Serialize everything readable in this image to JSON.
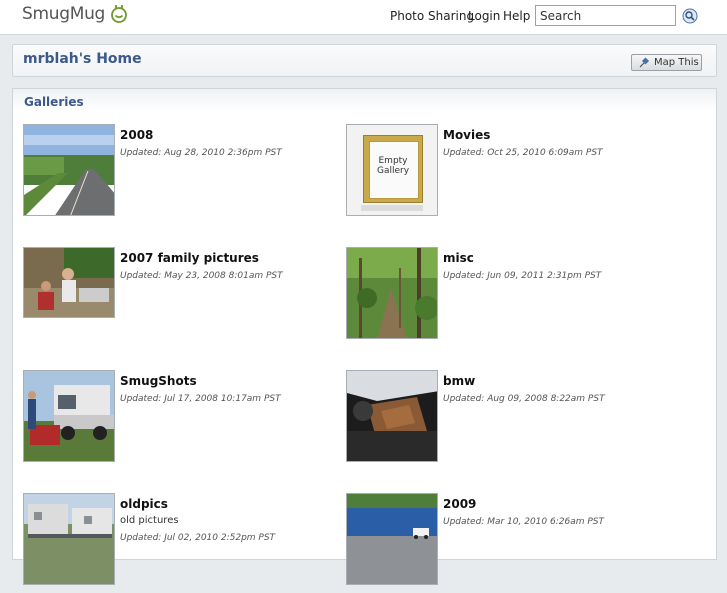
{
  "header": {
    "logo_text": "SmugMug",
    "nav": [
      "Photo Sharing",
      "Login",
      "Help"
    ],
    "search_value": "Search"
  },
  "page": {
    "title": "mrblah's Home",
    "map_button_label": "Map This"
  },
  "galleries": {
    "title": "Galleries",
    "items": [
      {
        "name": "2008",
        "updated": "Updated: Aug 28, 2010 2:36pm PST",
        "thumb": "highway"
      },
      {
        "name": "Movies",
        "updated": "Updated: Oct 25, 2010 6:09am PST",
        "thumb": "empty-gallery",
        "empty_text": "Empty Gallery"
      },
      {
        "name": "2007 family pictures",
        "updated": "Updated: May 23, 2008 8:01am PST",
        "thumb": "family"
      },
      {
        "name": "misc",
        "updated": "Updated: Jun 09, 2011 2:31pm PST",
        "thumb": "forest"
      },
      {
        "name": "SmugShots",
        "updated": "Updated: Jul 17, 2008 10:17am PST",
        "thumb": "truck"
      },
      {
        "name": "bmw",
        "updated": "Updated: Aug 09, 2008 8:22am PST",
        "thumb": "car-interior"
      },
      {
        "name": "oldpics",
        "description": "old pictures",
        "updated": "Updated: Jul 02, 2010 2:52pm PST",
        "thumb": "trailers"
      },
      {
        "name": "2009",
        "updated": "Updated: Mar 10, 2010 6:26am PST",
        "thumb": "blue-wall"
      }
    ]
  }
}
